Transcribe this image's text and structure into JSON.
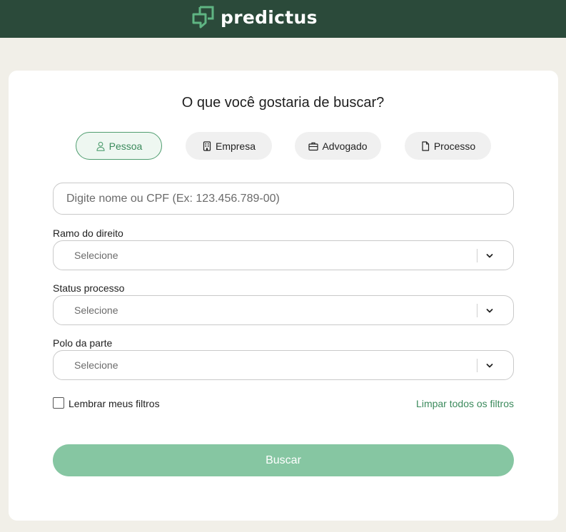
{
  "brand": {
    "name": "predictus",
    "color": "#2b4a3a",
    "accent": "#4f9d6f"
  },
  "search": {
    "title": "O que você gostaria de buscar?",
    "tabs": [
      {
        "label": "Pessoa",
        "icon": "person-icon",
        "active": true
      },
      {
        "label": "Empresa",
        "icon": "building-icon",
        "active": false
      },
      {
        "label": "Advogado",
        "icon": "briefcase-icon",
        "active": false
      },
      {
        "label": "Processo",
        "icon": "document-icon",
        "active": false
      }
    ],
    "placeholder": "Digite nome ou CPF (Ex: 123.456.789-00)",
    "value": ""
  },
  "filters": [
    {
      "label": "Ramo do direito",
      "value": "Selecione"
    },
    {
      "label": "Status processo",
      "value": "Selecione"
    },
    {
      "label": "Polo da parte",
      "value": "Selecione"
    }
  ],
  "remember": {
    "label": "Lembrar meus filtros",
    "checked": false
  },
  "clear_label": "Limpar todos os filtros",
  "submit_label": "Buscar"
}
